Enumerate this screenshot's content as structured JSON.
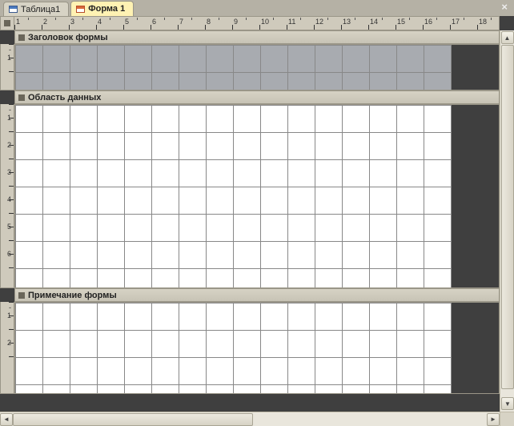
{
  "tabs": [
    {
      "label": "Таблица1",
      "icon": "table",
      "active": false
    },
    {
      "label": "Форма 1",
      "icon": "form",
      "active": true
    }
  ],
  "close_label": "×",
  "ruler_numbers": [
    "1",
    "2",
    "3",
    "4",
    "5",
    "6",
    "7",
    "8",
    "9",
    "10",
    "11",
    "12",
    "13",
    "14",
    "15",
    "16",
    "17",
    "18"
  ],
  "vruler": {
    "header": [
      "-",
      "1",
      "-"
    ],
    "detail": [
      "-",
      "1",
      "-",
      "2",
      "-",
      "3",
      "-",
      "4",
      "-",
      "5",
      "-",
      "6",
      "-"
    ],
    "footer": [
      "-",
      "1",
      "-",
      "2",
      "-"
    ]
  },
  "sections": {
    "header": "Заголовок формы",
    "detail": "Область данных",
    "footer": "Примечание формы"
  },
  "grid_cols": 16
}
